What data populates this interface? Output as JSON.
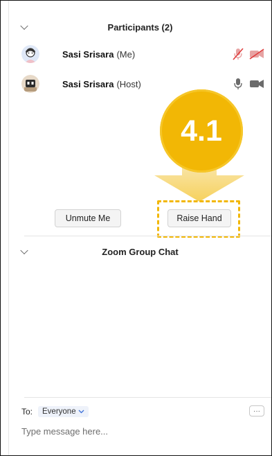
{
  "participants": {
    "title": "Participants (2)",
    "list": [
      {
        "name": "Sasi Srisara",
        "tag": "(Me)",
        "mic": "mic-muted-icon",
        "video": "video-off-icon"
      },
      {
        "name": "Sasi Srisara",
        "tag": "(Host)",
        "mic": "mic-icon",
        "video": "video-camera-icon"
      }
    ]
  },
  "buttons": {
    "unmute": "Unmute Me",
    "raise_hand": "Raise Hand"
  },
  "annotation": {
    "step": "4.1",
    "color": "#f2b705",
    "arrow_color": "#f6cf55"
  },
  "chat": {
    "title": "Zoom Group Chat",
    "to_label": "To:",
    "recipient": "Everyone",
    "more_label": "···",
    "placeholder": "Type message here..."
  },
  "colors": {
    "muted_red": "#e03c3c",
    "icon_gray": "#6b6b6b"
  }
}
